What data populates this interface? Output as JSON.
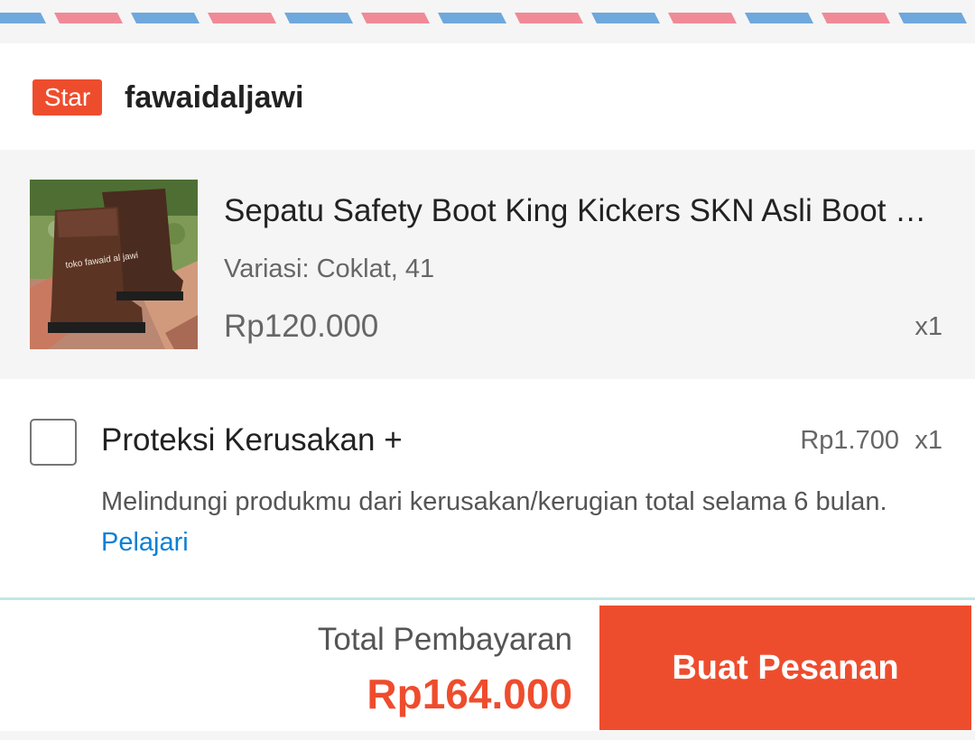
{
  "colors": {
    "accent": "#ee4d2d",
    "link": "#0a7fd6",
    "envelope_red": "#f08a97",
    "envelope_blue": "#6fa8dc"
  },
  "seller": {
    "badge": "Star",
    "name": "fawaidaljawi"
  },
  "product": {
    "image_icon": "safety-boot-photo",
    "name": "Sepatu Safety Boot King Kickers SKN Asli  Boot Coklat",
    "variation": "Variasi: Coklat, 41",
    "price": "Rp120.000",
    "quantity": "x1"
  },
  "protection": {
    "title": "Proteksi Kerusakan +",
    "price": "Rp1.700",
    "quantity": "x1",
    "description": "Melindungi produkmu dari kerusakan/kerugian total selama 6 bulan.",
    "link": "Pelajari",
    "checked": false
  },
  "footer": {
    "total_label": "Total Pembayaran",
    "total_amount": "Rp164.000",
    "order_button": "Buat Pesanan"
  }
}
